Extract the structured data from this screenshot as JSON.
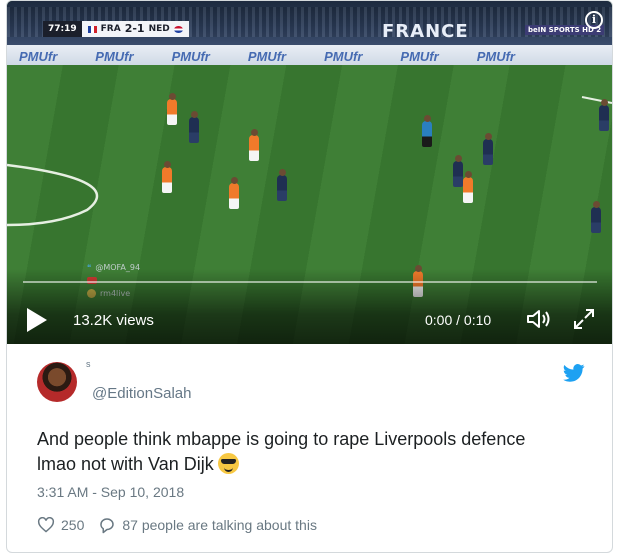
{
  "video": {
    "scorebug": {
      "clock": "77:19",
      "home": "FRA",
      "score": "2-1",
      "away": "NED"
    },
    "banner": "FRANCE",
    "broadcaster": "beIN SPORTS HD 2",
    "board_ad": "PMUfr",
    "watermarks": [
      "@MOFA_94",
      "rm4live"
    ],
    "views": "13.2K views",
    "time": "0:00 / 0:10",
    "progress": 0
  },
  "tweet": {
    "handle": "@EditionSalah",
    "avatar_mark": "s",
    "text_line1": "And people think mbappe is going to rape Liverpools defence",
    "text_line2": "lmao not with Van Dijk",
    "emoji": "smiling-face-with-sunglasses",
    "timestamp": "3:31 AM - Sep 10, 2018",
    "likes": "250",
    "talking": "87 people are talking about this"
  },
  "colors": {
    "twitter_blue": "#1da1f2",
    "meta_gray": "#697882"
  }
}
